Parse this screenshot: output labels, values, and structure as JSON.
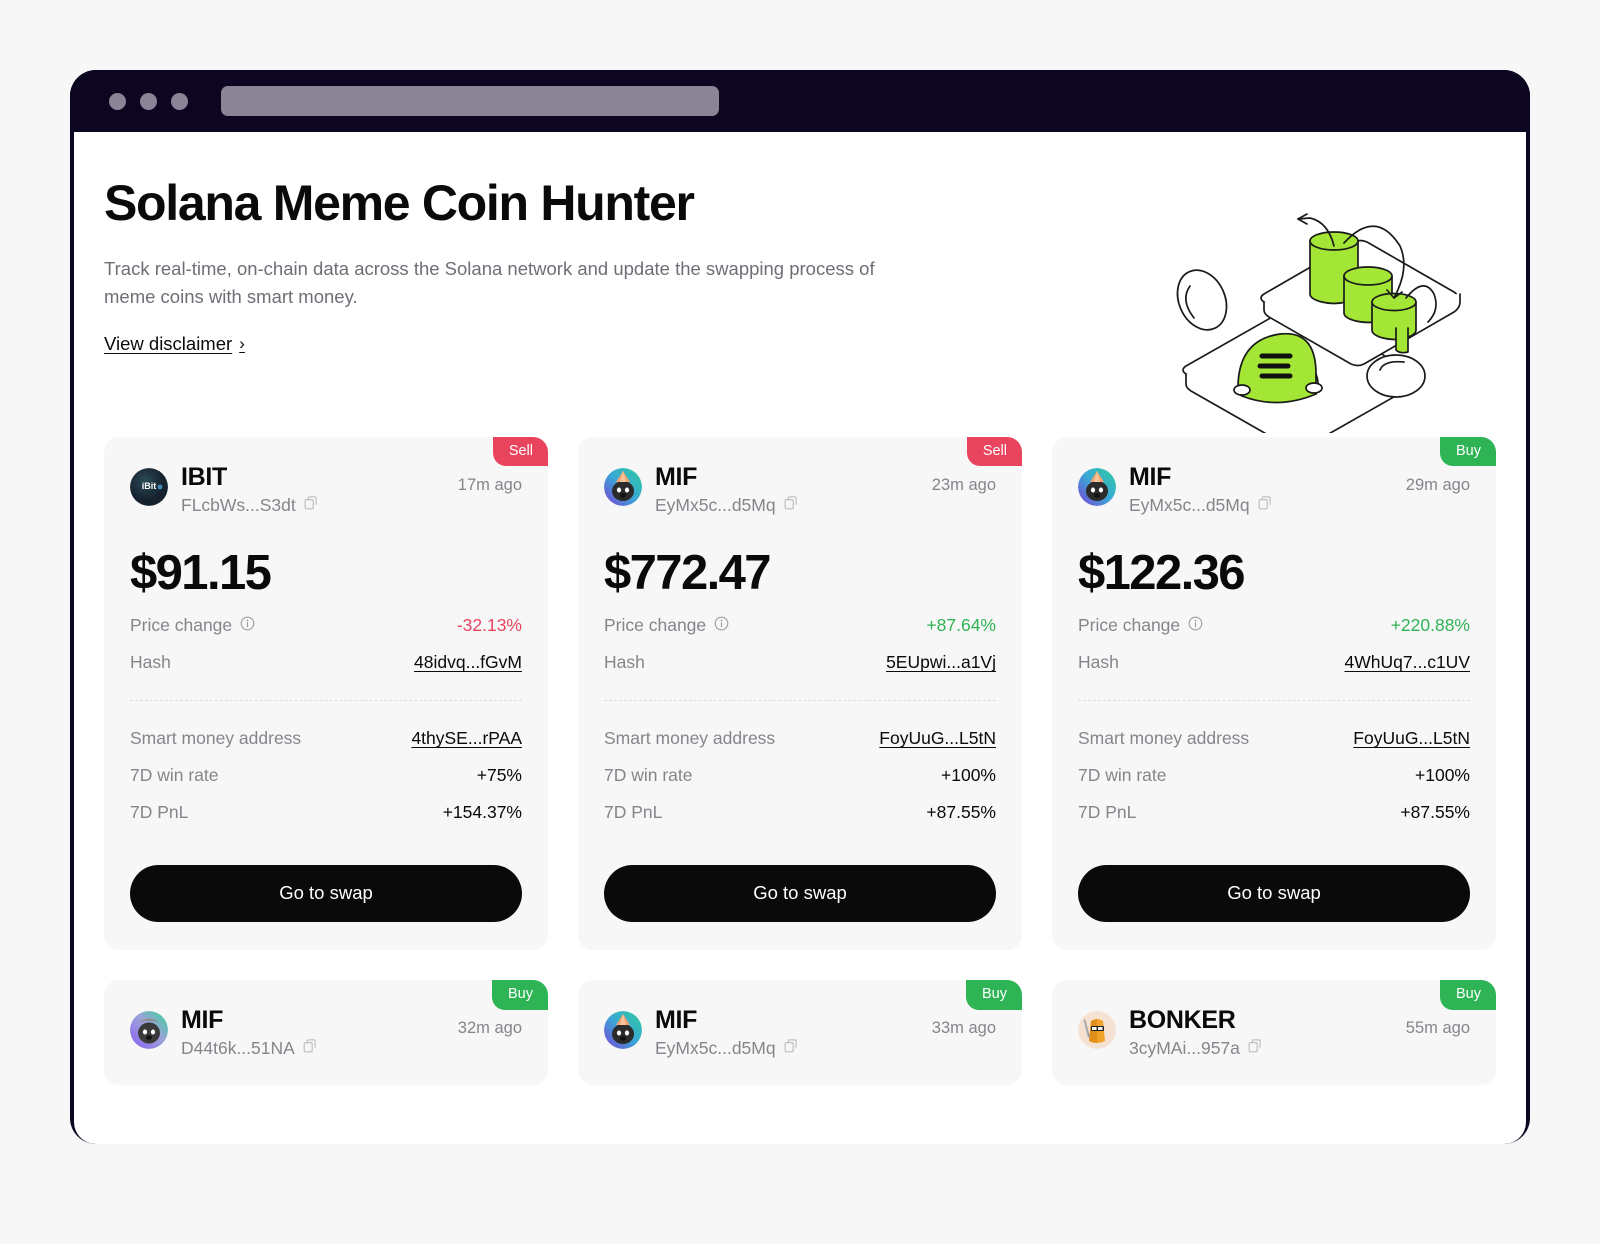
{
  "browser": {
    "dots_count": 3,
    "address_bar_value": "",
    "address_bar_placeholder": ""
  },
  "hero": {
    "title": "Solana Meme Coin Hunter",
    "description": "Track real-time, on-chain data across the Solana network and update the swapping process of meme coins with smart money.",
    "disclaimer_link": "View disclaimer",
    "chevron": "›"
  },
  "labels": {
    "price_change": "Price change",
    "hash": "Hash",
    "smart_money_address": "Smart money address",
    "win_rate": "7D win rate",
    "pnl": "7D PnL",
    "swap_button": "Go to swap"
  },
  "colors": {
    "buy": "#2eb355",
    "sell": "#e8445e",
    "positive": "#2eb355",
    "negative": "#e8445e",
    "accent_green": "#a3e635",
    "chrome": "#0d0620",
    "page_bg": "#f7f7f8",
    "card_bg": "#f7f7f7"
  },
  "cards": [
    {
      "badge": "Sell",
      "badge_type": "sell",
      "name": "IBIT",
      "address": "FLcbWs...S3dt",
      "time_ago": "17m ago",
      "price": "$91.15",
      "price_change": "-32.13%",
      "price_change_dir": "neg",
      "hash": "48idvq...fGvM",
      "smart_money_address": "4thySE...rPAA",
      "win_rate": "+75%",
      "pnl": "+154.37%",
      "avatar": "ibit-avatar"
    },
    {
      "badge": "Sell",
      "badge_type": "sell",
      "name": "MIF",
      "address": "EyMx5c...d5Mq",
      "time_ago": "23m ago",
      "price": "$772.47",
      "price_change": "+87.64%",
      "price_change_dir": "pos",
      "hash": "5EUpwi...a1Vj",
      "smart_money_address": "FoyUuG...L5tN",
      "win_rate": "+100%",
      "pnl": "+87.55%",
      "avatar": "mif-avatar"
    },
    {
      "badge": "Buy",
      "badge_type": "buy",
      "name": "MIF",
      "address": "EyMx5c...d5Mq",
      "time_ago": "29m ago",
      "price": "$122.36",
      "price_change": "+220.88%",
      "price_change_dir": "pos",
      "hash": "4WhUq7...c1UV",
      "smart_money_address": "FoyUuG...L5tN",
      "win_rate": "+100%",
      "pnl": "+87.55%",
      "avatar": "mif-avatar"
    }
  ],
  "cards_row2": [
    {
      "badge": "Buy",
      "badge_type": "buy",
      "name": "MIF",
      "address": "D44t6k...51NA",
      "time_ago": "32m ago",
      "avatar": "mif-avatar-alt"
    },
    {
      "badge": "Buy",
      "badge_type": "buy",
      "name": "MIF",
      "address": "EyMx5c...d5Mq",
      "time_ago": "33m ago",
      "avatar": "mif-avatar"
    },
    {
      "badge": "Buy",
      "badge_type": "buy",
      "name": "BONKER",
      "address": "3cyMAi...957a",
      "time_ago": "55m ago",
      "avatar": "bonker-avatar"
    }
  ]
}
